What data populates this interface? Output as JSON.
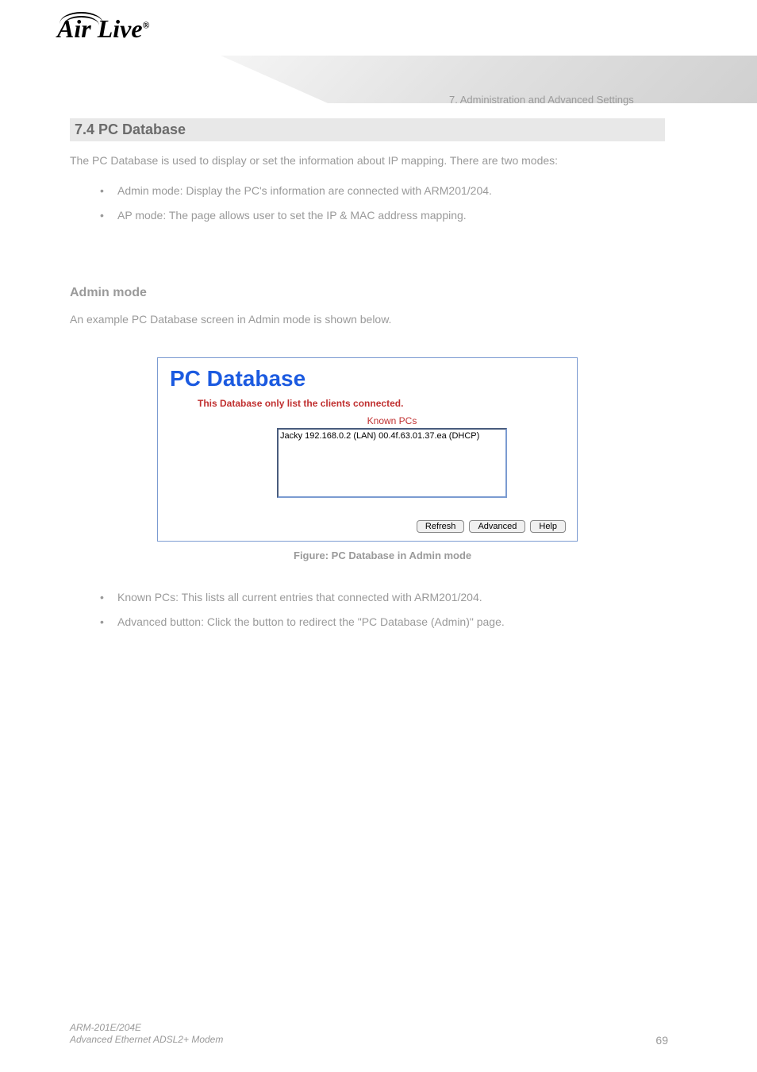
{
  "logo": {
    "brand": "Air Live",
    "reg": "®"
  },
  "chapter": "7. Administration and Advanced Settings",
  "section": "7.4 PC Database",
  "intro": {
    "lead": "The PC Database is used to display or set the information about IP mapping. There are two modes:",
    "bullets": [
      "Admin mode: Display the PC's information are connected with ARM201/204.",
      "AP mode: The page allows user to set the IP & MAC address mapping."
    ]
  },
  "admin_mode_heading": "Admin mode",
  "admin_mode_text": "An example PC Database screen in Admin mode is shown below.",
  "app": {
    "title": "PC Database",
    "subtitle": "This Database only list the clients connected.",
    "known_label": "Known PCs",
    "list_item": "Jacky 192.168.0.2 (LAN) 00.4f.63.01.37.ea (DHCP)",
    "buttons": {
      "refresh": "Refresh",
      "advanced": "Advanced",
      "help": "Help"
    }
  },
  "figure_caption": "Figure: PC Database in Admin mode",
  "bullets_after": [
    "Known PCs: This lists all current entries that connected with ARM201/204.",
    "Advanced button: Click the button to redirect the \"PC Database (Admin)\" page."
  ],
  "footer": {
    "page": "69",
    "model": "ARM-201E/204E",
    "desc": "Advanced Ethernet ADSL2+ Modem"
  }
}
